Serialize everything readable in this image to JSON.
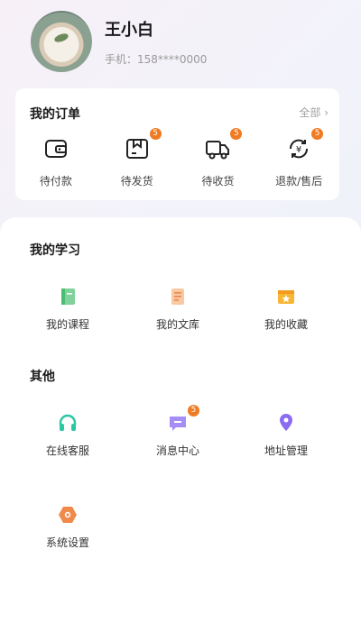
{
  "profile": {
    "name": "王小白",
    "phone": "手机：158****0000"
  },
  "orders": {
    "title": "我的订单",
    "all_label": "全部",
    "items": [
      {
        "label": "待付款",
        "icon": "wallet-icon",
        "badge": ""
      },
      {
        "label": "待发货",
        "icon": "package-icon",
        "badge": "5"
      },
      {
        "label": "待收货",
        "icon": "truck-icon",
        "badge": "5"
      },
      {
        "label": "退款/售后",
        "icon": "refund-icon",
        "badge": "5"
      }
    ]
  },
  "study": {
    "title": "我的学习",
    "items": [
      {
        "label": "我的课程",
        "icon": "course-icon"
      },
      {
        "label": "我的文库",
        "icon": "library-icon"
      },
      {
        "label": "我的收藏",
        "icon": "favorites-icon"
      }
    ]
  },
  "other": {
    "title": "其他",
    "items": [
      {
        "label": "在线客服",
        "icon": "headset-icon",
        "badge": ""
      },
      {
        "label": "消息中心",
        "icon": "message-icon",
        "badge": "5"
      },
      {
        "label": "地址管理",
        "icon": "location-icon",
        "badge": ""
      },
      {
        "label": "系统设置",
        "icon": "settings-icon",
        "badge": ""
      }
    ]
  },
  "colors": {
    "badge": "#f07a21",
    "accent_green": "#2bc7a3",
    "accent_purple": "#8b6cf0"
  }
}
